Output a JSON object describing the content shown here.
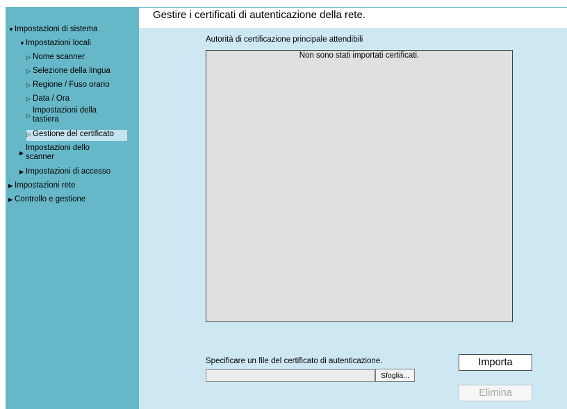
{
  "sidebar": {
    "items": [
      {
        "label": "Impostazioni di sistema",
        "icon": "triangle-down-icon"
      },
      {
        "label": "Impostazioni locali",
        "icon": "triangle-down-icon"
      },
      {
        "label": "Nome scanner",
        "icon": "triangle-right-outline-icon"
      },
      {
        "label": "Selezione della lingua",
        "icon": "triangle-right-outline-icon"
      },
      {
        "label": "Regione / Fuso orario",
        "icon": "triangle-right-outline-icon"
      },
      {
        "label": "Data / Ora",
        "icon": "triangle-right-outline-icon"
      },
      {
        "label": "Impostazioni della tastiera",
        "icon": "triangle-right-outline-icon"
      },
      {
        "label": "Gestione del certificato",
        "icon": "triangle-right-outline-icon",
        "selected": true
      },
      {
        "label": "Impostazioni dello scanner",
        "icon": "triangle-right-icon"
      },
      {
        "label": "Impostazioni di accesso",
        "icon": "triangle-right-icon"
      },
      {
        "label": "Impostazioni rete",
        "icon": "triangle-right-icon"
      },
      {
        "label": "Controllo e gestione",
        "icon": "triangle-right-icon"
      }
    ]
  },
  "main": {
    "title": "Gestire i certificati di autenticazione della rete.",
    "list_label": "Autorità di certificazione principale attendibili",
    "empty_message": "Non sono stati importati certificati.",
    "file_label": "Specificare un file del certificato di autenticazione.",
    "file_value": "",
    "browse_label": "Sfoglia...",
    "import_label": "Importa",
    "delete_label": "Elimina"
  },
  "colors": {
    "sidebar_bg": "#66b8c8",
    "content_bg": "#cde8f3",
    "selected_item_bg": "#c4e3ec",
    "list_bg": "#e0e0e0"
  }
}
